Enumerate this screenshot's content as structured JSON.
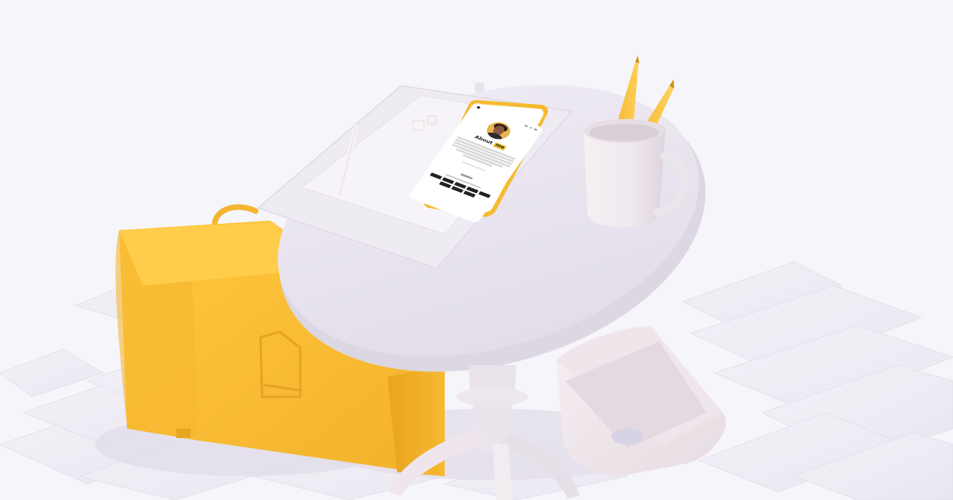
{
  "scene": {
    "background": "#f6f5fa",
    "accent": "#f7c23a",
    "surface": "#ece8f0"
  },
  "phone": {
    "heading_prefix": "About",
    "heading_highlight": "me",
    "tags": [
      "",
      "",
      "",
      "",
      "",
      "",
      "",
      ""
    ]
  }
}
